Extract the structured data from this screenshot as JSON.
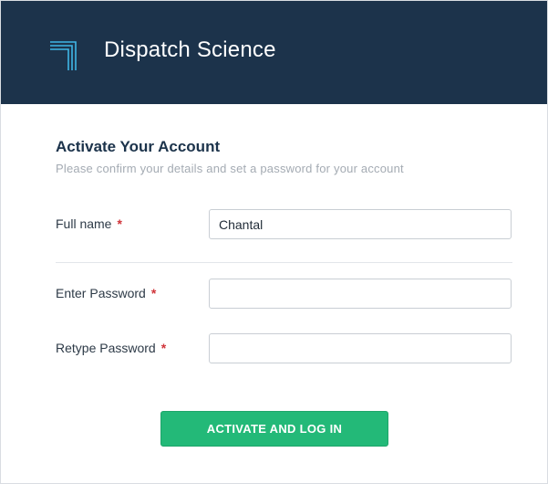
{
  "header": {
    "brand_name": "Dispatch Science",
    "logo_icon": "dispatch-science-logo-icon",
    "background_color": "#1c334b",
    "logo_color": "#3fb6e6"
  },
  "form": {
    "title": "Activate Your Account",
    "subtitle": "Please confirm your details and set a password for your account",
    "required_marker": "*",
    "fields": {
      "full_name": {
        "label": "Full name",
        "value": "Chantal",
        "placeholder": ""
      },
      "password": {
        "label": "Enter Password",
        "value": "",
        "placeholder": ""
      },
      "retype_password": {
        "label": "Retype Password",
        "value": "",
        "placeholder": ""
      }
    },
    "submit_label": "ACTIVATE AND LOG IN",
    "accent_color": "#23b978",
    "required_color": "#d0343a"
  }
}
